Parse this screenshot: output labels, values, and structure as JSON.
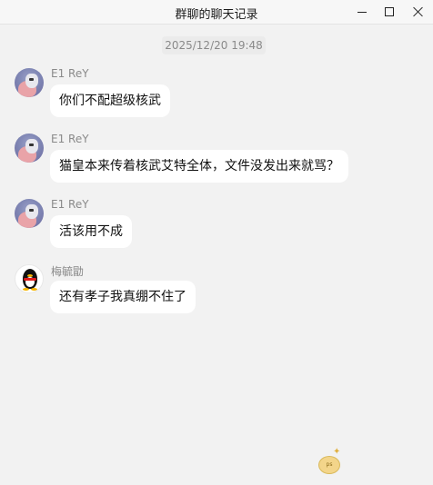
{
  "window": {
    "title": "群聊的聊天记录",
    "controls": {
      "minimize": "minimize-icon",
      "maximize": "maximize-icon",
      "close": "close-icon"
    }
  },
  "chat": {
    "timestamp": "2025/12/20 19:48",
    "messages": [
      {
        "sender": "E1 ReY",
        "avatar": "photo-avatar",
        "text": "你们不配超级核武"
      },
      {
        "sender": "E1 ReY",
        "avatar": "photo-avatar",
        "text": "猫皇本来传着核武艾特全体，文件没发出来就骂？"
      },
      {
        "sender": "E1 ReY",
        "avatar": "photo-avatar",
        "text": "活该用不成"
      },
      {
        "sender": "梅毓勖",
        "avatar": "qq-penguin-avatar",
        "text": "还有孝子我真绷不住了"
      }
    ]
  },
  "watermark": {
    "icon": "watermark-logo-icon"
  }
}
